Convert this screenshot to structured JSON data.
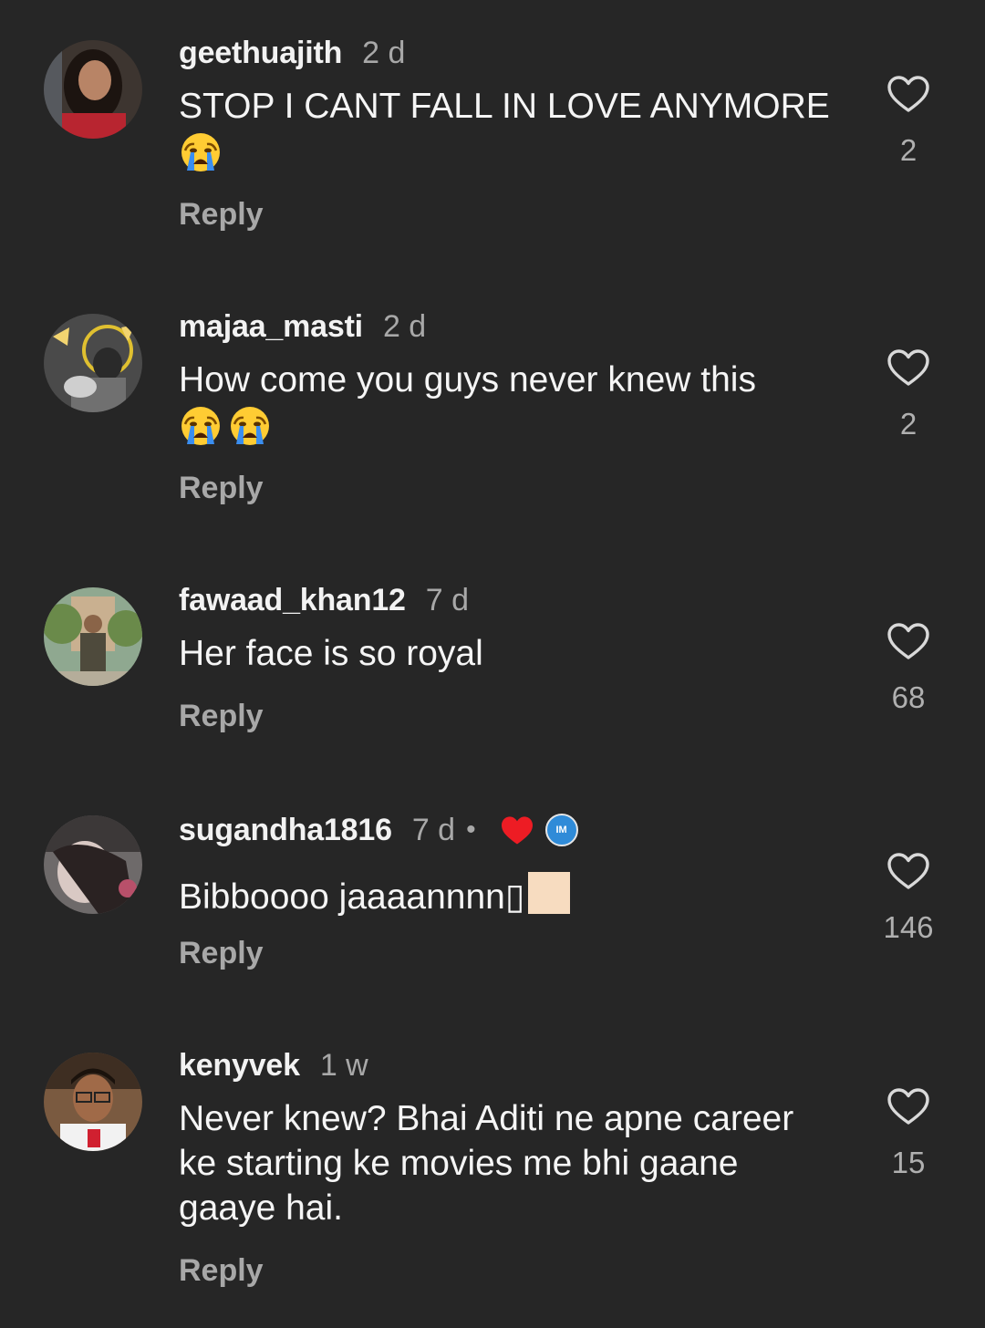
{
  "reply_label": "Reply",
  "comments": [
    {
      "username": "geethuajith",
      "time": "2 d",
      "text": "STOP I CANT FALL IN LOVE ANYMORE",
      "emojis": [
        "crying-face"
      ],
      "likes": "2"
    },
    {
      "username": "majaa_masti",
      "time": "2 d",
      "text": "How come you guys never knew this",
      "emojis": [
        "crying-face",
        "crying-face"
      ],
      "likes": "2"
    },
    {
      "username": "fawaad_khan12",
      "time": "7 d",
      "text": "Her face is so royal",
      "likes": "68"
    },
    {
      "username": "sugandha1816",
      "time": "7 d",
      "dot": "•",
      "creator_badge": "IM",
      "text": "Bibboooo jaaaannnn▯",
      "likes": "146"
    },
    {
      "username": "kenyvek",
      "time": "1 w",
      "text": "Never knew? Bhai Aditi ne apne career ke starting ke movies me bhi gaane gaaye hai.",
      "likes": "15"
    }
  ],
  "colors": {
    "background": "#262626",
    "primary_text": "#f5f5f5",
    "secondary_text": "#a8a8a8",
    "liked_heart": "#ed1c24",
    "creator_badge": "#2f8bd8"
  }
}
